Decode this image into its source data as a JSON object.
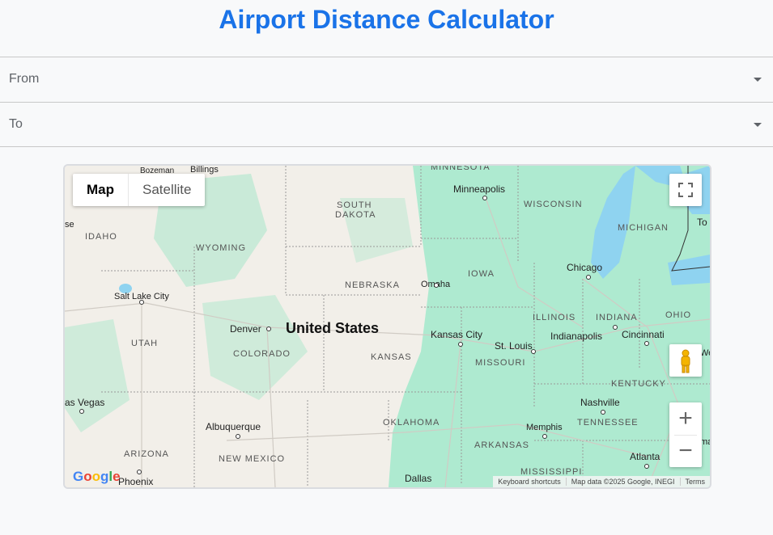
{
  "title": "Airport Distance Calculator",
  "from": {
    "label": "From"
  },
  "to": {
    "label": "To"
  },
  "map": {
    "type_buttons": {
      "map": "Map",
      "satellite": "Satellite"
    },
    "country_label": "United States",
    "states": [
      {
        "name": "SOUTH",
        "key": "sd1"
      },
      {
        "name": "DAKOTA",
        "key": "sd2"
      },
      {
        "name": "WISCONSIN",
        "key": "wi"
      },
      {
        "name": "MICHIGAN",
        "key": "mi"
      },
      {
        "name": "IDAHO",
        "key": "id"
      },
      {
        "name": "WYOMING",
        "key": "wy"
      },
      {
        "name": "IOWA",
        "key": "ia"
      },
      {
        "name": "NEBRASKA",
        "key": "ne"
      },
      {
        "name": "ILLINOIS",
        "key": "il"
      },
      {
        "name": "INDIANA",
        "key": "in"
      },
      {
        "name": "OHIO",
        "key": "oh"
      },
      {
        "name": "UTAH",
        "key": "ut"
      },
      {
        "name": "COLORADO",
        "key": "co"
      },
      {
        "name": "KANSAS",
        "key": "ks"
      },
      {
        "name": "MISSOURI",
        "key": "mo"
      },
      {
        "name": "KENTUCKY",
        "key": "ky"
      },
      {
        "name": "TENNESSEE",
        "key": "tn"
      },
      {
        "name": "OKLAHOMA",
        "key": "ok"
      },
      {
        "name": "ARKANSAS",
        "key": "ar"
      },
      {
        "name": "ARIZONA",
        "key": "az"
      },
      {
        "name": "NEW MEXICO",
        "key": "nm"
      },
      {
        "name": "MISSISSIPPI",
        "key": "ms"
      },
      {
        "name": "MINNESOTA",
        "key": "mn"
      }
    ],
    "cities": {
      "bozeman": "Bozeman",
      "billings": "Billings",
      "minneapolis": "Minneapolis",
      "chicago": "Chicago",
      "omaha": "Omaha",
      "salt_lake": "Salt Lake City",
      "denver": "Denver",
      "kansas_city": "Kansas City",
      "st_louis": "St. Louis",
      "indianapolis": "Indianapolis",
      "cincinnati": "Cincinnati",
      "nashville": "Nashville",
      "memphis": "Memphis",
      "atlanta": "Atlanta",
      "albuquerque": "Albuquerque",
      "las_vegas": "as Vegas",
      "phoenix": "Phoenix",
      "dallas": "Dallas",
      "toronto": "To",
      "boise": "se",
      "ohio_edge": "We",
      "alabama_edge": "ma"
    },
    "attribution": {
      "shortcuts": "Keyboard shortcuts",
      "data": "Map data ©2025 Google, INEGI",
      "terms": "Terms"
    },
    "logo": "Google",
    "colors": {
      "land": "#f2efe9",
      "green": "#aeead0",
      "water": "#8fd3f0",
      "title": "#1a73e8"
    }
  }
}
